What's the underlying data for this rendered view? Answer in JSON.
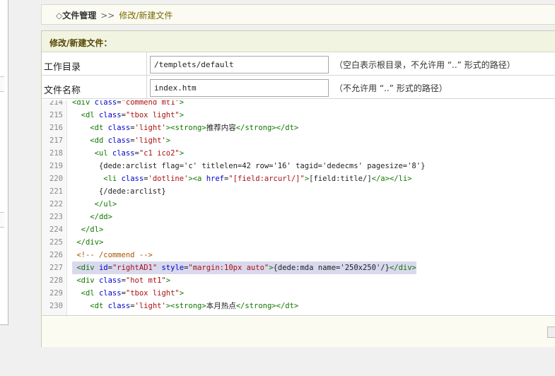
{
  "breadcrumb": {
    "bullet": "◇",
    "root": "文件管理",
    "separator": ">>",
    "current": "修改/新建文件"
  },
  "panel": {
    "title": "修改/新建文件："
  },
  "form": {
    "workdir_label": "工作目录",
    "workdir_value": "/templets/default",
    "workdir_hint": "（空白表示根目录，不允许用 “..” 形式的路径）",
    "filename_label": "文件名称",
    "filename_value": "index.htm",
    "filename_hint": "（不允许用 “..” 形式的路径）"
  },
  "editor": {
    "highlighted_line": 227,
    "lines": [
      {
        "n": "214",
        "code": "<div class=\"commend mt1\">"
      },
      {
        "n": "215",
        "code": "  <dl class=\"tbox light\">"
      },
      {
        "n": "216",
        "code": "    <dt class='light'><strong>推荐内容</strong></dt>"
      },
      {
        "n": "217",
        "code": "    <dd class='light'>"
      },
      {
        "n": "218",
        "code": "     <ul class=\"c1 ico2\">"
      },
      {
        "n": "219",
        "code": "      {dede:arclist flag='c' titlelen=42 row='16' tagid='dedecms' pagesize='8'}"
      },
      {
        "n": "220",
        "code": "       <li class='dotline'><a href=\"[field:arcurl/]\">[field:title/]</a></li>"
      },
      {
        "n": "221",
        "code": "      {/dede:arclist}"
      },
      {
        "n": "222",
        "code": "     </ul>"
      },
      {
        "n": "223",
        "code": "    </dd>"
      },
      {
        "n": "224",
        "code": "  </dl>"
      },
      {
        "n": "225",
        "code": " </div>"
      },
      {
        "n": "226",
        "code": " <!-- /commend -->"
      },
      {
        "n": "227",
        "code": " <div id=\"rightAD1\" style=\"margin:10px auto\">{dede:mda name='250x250'/}</div>"
      },
      {
        "n": "228",
        "code": " <div class=\"hot mt1\">"
      },
      {
        "n": "229",
        "code": "  <dl class=\"tbox light\">"
      },
      {
        "n": "230",
        "code": "    <dt class='light'><strong>本月热点</strong></dt>"
      }
    ]
  },
  "colors": {
    "tag": "#117700",
    "attribute": "#0000cc",
    "string": "#aa1111",
    "comment": "#aa5500",
    "highlight": "#d9d9ee"
  }
}
